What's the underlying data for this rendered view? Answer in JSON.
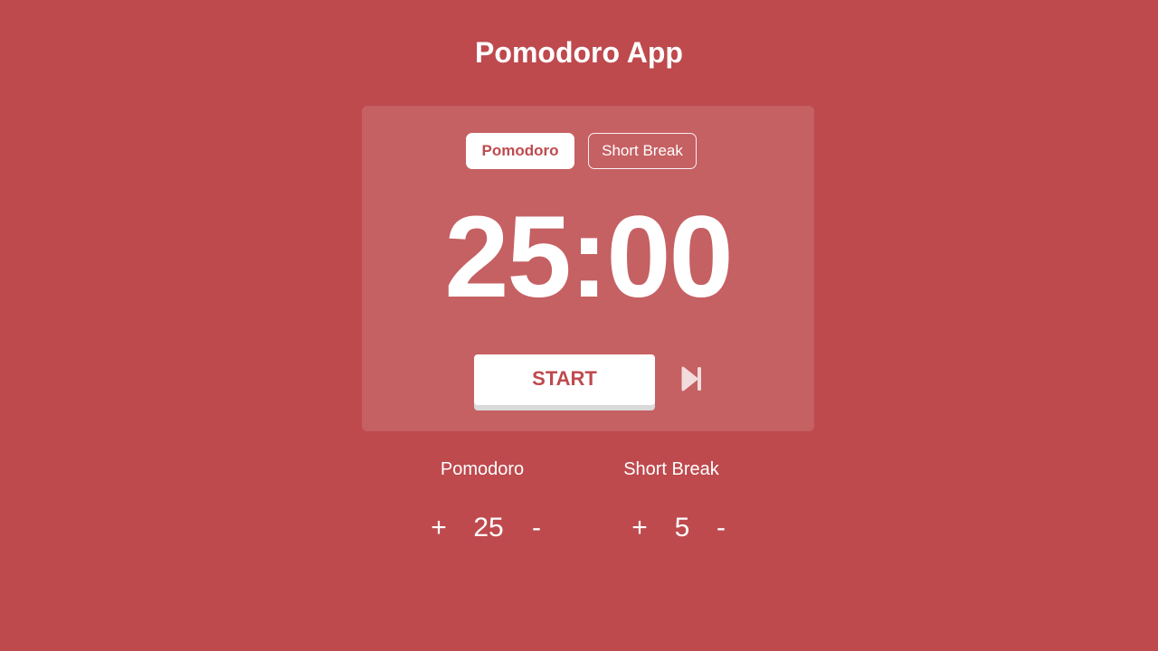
{
  "app": {
    "title": "Pomodoro App"
  },
  "modes": {
    "pomodoro_label": "Pomodoro",
    "short_break_label": "Short Break",
    "active": "Pomodoro"
  },
  "timer": {
    "display": "25:00"
  },
  "controls": {
    "start_label": "START",
    "skip_icon": "skip-next-icon"
  },
  "settings": {
    "pomodoro": {
      "label": "Pomodoro",
      "increment": "+",
      "value": "25",
      "decrement": "-"
    },
    "short_break": {
      "label": "Short Break",
      "increment": "+",
      "value": "5",
      "decrement": "-"
    }
  },
  "colors": {
    "background": "#be4a4e",
    "card": "rgba(255,255,255,0.12)",
    "accent_text": "#be4a4e",
    "foreground": "#ffffff"
  }
}
